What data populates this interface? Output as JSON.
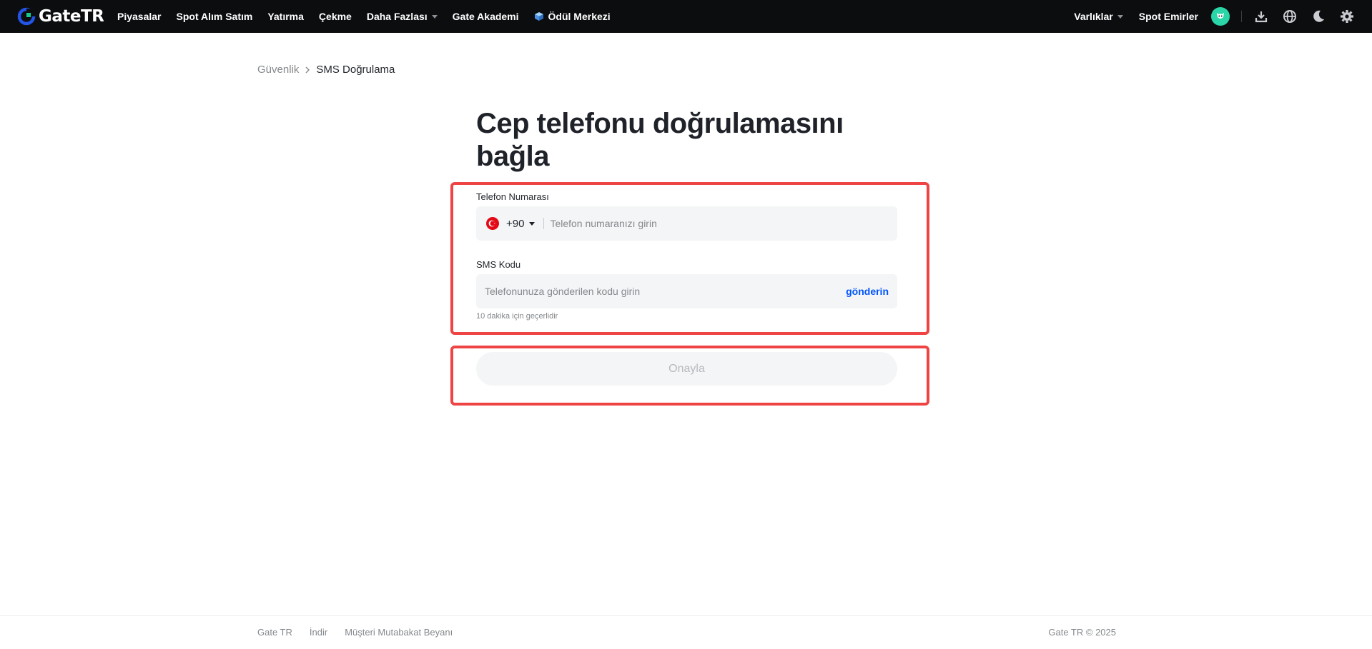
{
  "brand": {
    "name": "GateTR"
  },
  "nav": {
    "items": [
      {
        "label": "Piyasalar"
      },
      {
        "label": "Spot Alım Satım"
      },
      {
        "label": "Yatırma"
      },
      {
        "label": "Çekme"
      },
      {
        "label": "Daha Fazlası",
        "has_dropdown": true
      },
      {
        "label": "Gate Akademi"
      },
      {
        "label": "Ödül Merkezi",
        "icon": "cube-icon"
      }
    ],
    "right": {
      "assets_label": "Varlıklar",
      "orders_label": "Spot Emirler",
      "icons": [
        "avatar",
        "download-icon",
        "globe-icon",
        "moon-icon",
        "gear-icon"
      ]
    }
  },
  "breadcrumb": {
    "parent": "Güvenlik",
    "current": "SMS Doğrulama"
  },
  "form": {
    "title_line1": "Cep telefonu doğrulamasını",
    "title_line2": "bağla",
    "phone_label": "Telefon Numarası",
    "country_code": "+90",
    "phone_placeholder": "Telefon numaranızı girin",
    "sms_label": "SMS Kodu",
    "sms_placeholder": "Telefonunuza gönderilen kodu girin",
    "send_label": "gönderin",
    "hint": "10 dakika için geçerlidir",
    "confirm_label": "Onayla"
  },
  "footer": {
    "links": [
      "Gate TR",
      "İndir",
      "Müşteri Mutabakat Beyanı"
    ],
    "copyright": "Gate TR © 2025"
  },
  "colors": {
    "accent": "#0055ff",
    "highlight": "#ef4444",
    "nav_bg": "#0c0d0f"
  }
}
